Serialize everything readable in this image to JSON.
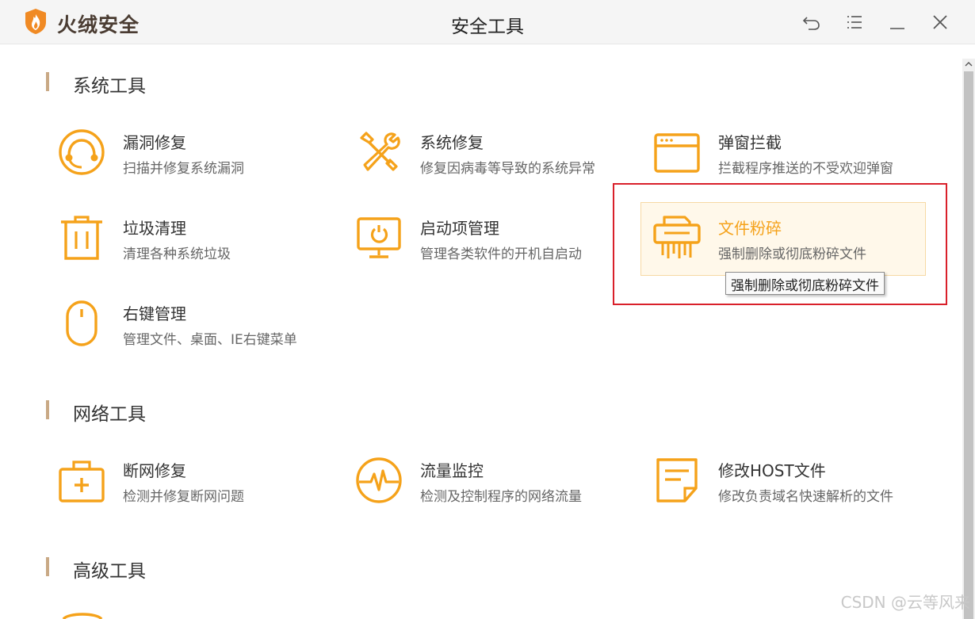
{
  "app": {
    "name": "火绒安全",
    "window_title": "安全工具"
  },
  "colors": {
    "accent": "#f5a21a",
    "section_bar": "#c9a985",
    "highlight": "#d9202a"
  },
  "sections": [
    {
      "title": "系统工具"
    },
    {
      "title": "网络工具"
    },
    {
      "title": "高级工具"
    }
  ],
  "tools": {
    "vuln_fix": {
      "name": "漏洞修复",
      "desc": "扫描并修复系统漏洞",
      "icon": "vulnerability-icon"
    },
    "sys_repair": {
      "name": "系统修复",
      "desc": "修复因病毒等导致的系统异常",
      "icon": "wrench-screwdriver-icon"
    },
    "popup_block": {
      "name": "弹窗拦截",
      "desc": "拦截程序推送的不受欢迎弹窗",
      "icon": "window-icon"
    },
    "junk_clean": {
      "name": "垃圾清理",
      "desc": "清理各种系统垃圾",
      "icon": "trash-icon"
    },
    "startup_mgr": {
      "name": "启动项管理",
      "desc": "管理各类软件的开机自启动",
      "icon": "monitor-power-icon"
    },
    "file_shred": {
      "name": "文件粉碎",
      "desc": "强制删除或彻底粉碎文件",
      "icon": "shredder-icon"
    },
    "context_menu": {
      "name": "右键管理",
      "desc": "管理文件、桌面、IE右键菜单",
      "icon": "mouse-icon"
    },
    "net_repair": {
      "name": "断网修复",
      "desc": "检测并修复断网问题",
      "icon": "first-aid-kit-icon"
    },
    "traffic_mon": {
      "name": "流量监控",
      "desc": "检测及控制程序的网络流量",
      "icon": "pulse-gauge-icon"
    },
    "host_edit": {
      "name": "修改HOST文件",
      "desc": "修改负责域名快速解析的文件",
      "icon": "document-icon"
    }
  },
  "tooltip": "强制删除或彻底粉碎文件",
  "watermark": "CSDN @云等风来"
}
